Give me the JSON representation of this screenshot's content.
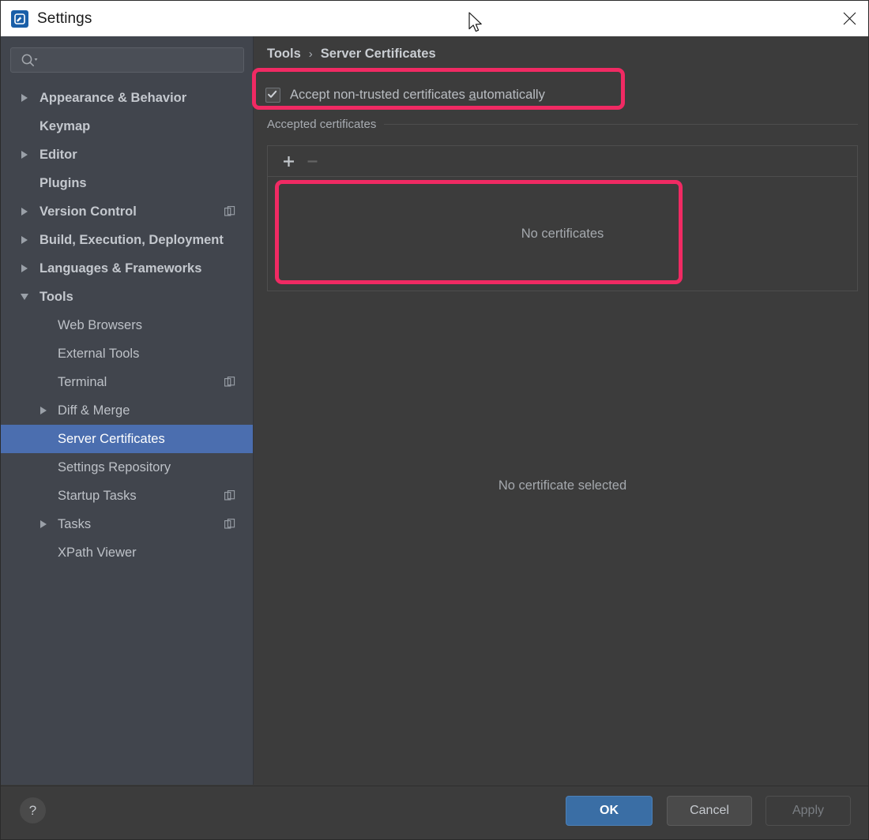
{
  "window": {
    "title": "Settings",
    "app_icon": "app-logo-icon",
    "close_icon": "close-icon"
  },
  "sidebar": {
    "search": {
      "value": "",
      "placeholder": "",
      "icon": "search-icon"
    },
    "items": [
      {
        "label": "Appearance & Behavior",
        "level": 0,
        "expander": "collapsed",
        "selected": false,
        "badge": false
      },
      {
        "label": "Keymap",
        "level": 0,
        "expander": "none",
        "selected": false,
        "badge": false
      },
      {
        "label": "Editor",
        "level": 0,
        "expander": "collapsed",
        "selected": false,
        "badge": false
      },
      {
        "label": "Plugins",
        "level": 0,
        "expander": "none",
        "selected": false,
        "badge": false
      },
      {
        "label": "Version Control",
        "level": 0,
        "expander": "collapsed",
        "selected": false,
        "badge": true
      },
      {
        "label": "Build, Execution, Deployment",
        "level": 0,
        "expander": "collapsed",
        "selected": false,
        "badge": false
      },
      {
        "label": "Languages & Frameworks",
        "level": 0,
        "expander": "collapsed",
        "selected": false,
        "badge": false
      },
      {
        "label": "Tools",
        "level": 0,
        "expander": "expanded",
        "selected": false,
        "badge": false
      },
      {
        "label": "Web Browsers",
        "level": 1,
        "expander": "none",
        "selected": false,
        "badge": false
      },
      {
        "label": "External Tools",
        "level": 1,
        "expander": "none",
        "selected": false,
        "badge": false
      },
      {
        "label": "Terminal",
        "level": 1,
        "expander": "none",
        "selected": false,
        "badge": true
      },
      {
        "label": "Diff & Merge",
        "level": 1,
        "expander": "collapsed",
        "selected": false,
        "badge": false
      },
      {
        "label": "Server Certificates",
        "level": 1,
        "expander": "none",
        "selected": true,
        "badge": false
      },
      {
        "label": "Settings Repository",
        "level": 1,
        "expander": "none",
        "selected": false,
        "badge": false
      },
      {
        "label": "Startup Tasks",
        "level": 1,
        "expander": "none",
        "selected": false,
        "badge": true
      },
      {
        "label": "Tasks",
        "level": 1,
        "expander": "collapsed",
        "selected": false,
        "badge": true
      },
      {
        "label": "XPath Viewer",
        "level": 1,
        "expander": "none",
        "selected": false,
        "badge": false
      }
    ]
  },
  "main": {
    "breadcrumb": {
      "parent": "Tools",
      "separator": "›",
      "current": "Server Certificates"
    },
    "accept_checkbox": {
      "checked": true,
      "text_before": "Accept non-trusted certificates ",
      "mnemonic": "a",
      "text_after": "utomatically"
    },
    "group_title": "Accepted certificates",
    "toolbar": {
      "add_label": "+",
      "add_icon": "plus-icon",
      "remove_label": "−",
      "remove_icon": "minus-icon",
      "remove_disabled": true
    },
    "empty_list_text": "No certificates",
    "no_selection_text": "No certificate selected"
  },
  "footer": {
    "help_label": "?",
    "ok_label": "OK",
    "cancel_label": "Cancel",
    "apply_label": "Apply",
    "apply_disabled": true
  },
  "annotations": {
    "color": "#f02a63",
    "boxes": [
      "accept-checkbox-row",
      "certificate-list-area"
    ]
  }
}
